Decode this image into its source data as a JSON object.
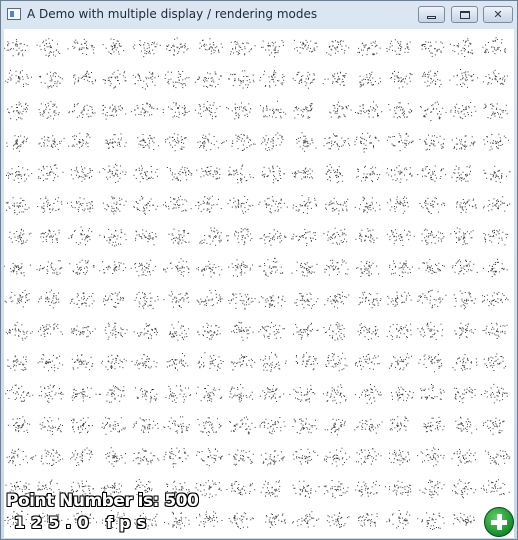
{
  "window": {
    "title": "A Demo with multiple display / rendering modes",
    "controls": {
      "minimize": "minimize",
      "maximize": "maximize",
      "close": "✕"
    }
  },
  "overlay": {
    "point_number": "Point Number is: 500",
    "fps": "125.0 fps"
  },
  "colors": {
    "point": "#3a3a3a",
    "background": "#ffffff",
    "add_button": "#1f9a35"
  },
  "icons": {
    "app": "app-icon",
    "add": "add-circle-icon"
  }
}
